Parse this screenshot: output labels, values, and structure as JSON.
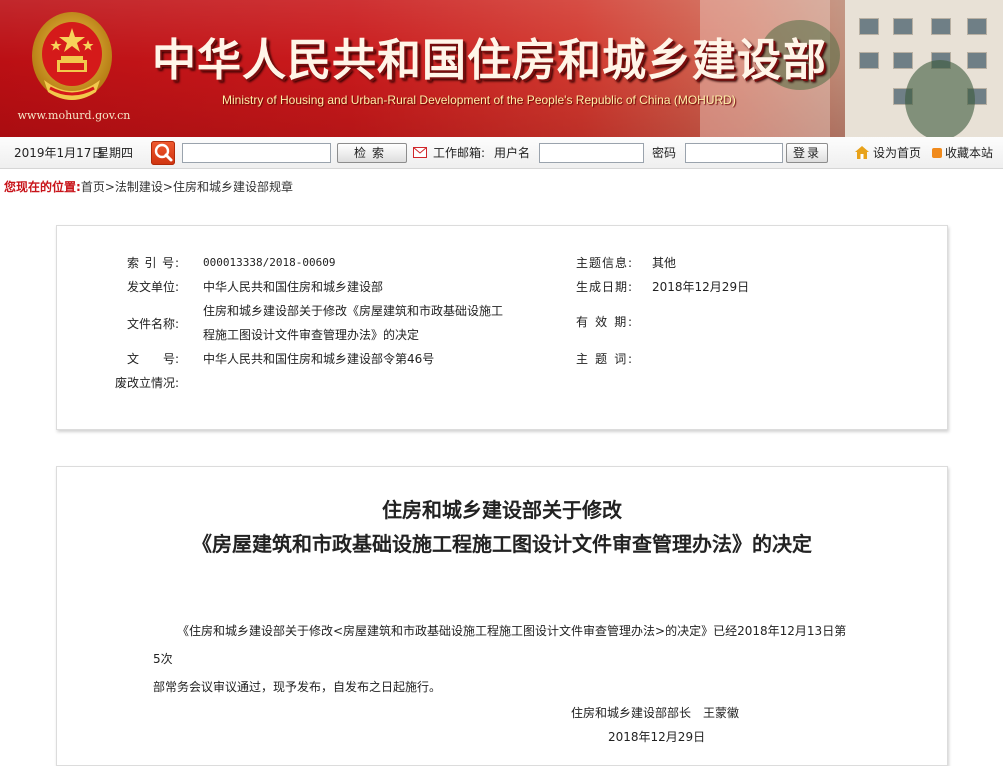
{
  "header": {
    "site_url": "www.mohurd.gov.cn",
    "title_cn": "中华人民共和国住房和城乡建设部",
    "title_en": "Ministry of Housing and Urban-Rural Development of the People's Republic of China (MOHURD)",
    "colors": {
      "banner_red": "#c91a1c",
      "title_gold": "#ffefa8"
    }
  },
  "toolbar": {
    "date": "2019年1月17日",
    "weekday": "星期四",
    "search_value": "",
    "search_button": "检索",
    "mail_label": "工作邮箱:",
    "username_label": "用户名",
    "username_value": "",
    "password_label": "密码",
    "password_value": "",
    "login_button": "登录",
    "set_home": "设为首页",
    "bookmark": "收藏本站"
  },
  "breadcrumb": {
    "label": "您现在的位置:",
    "items": [
      "首页",
      ">",
      "法制建设",
      ">",
      "住房和城乡建设部规章"
    ]
  },
  "info": {
    "index_label": "索 引 号:",
    "index_value": "000013338/2018-00609",
    "issuer_label": "发文单位:",
    "issuer_value": "中华人民共和国住房和城乡建设部",
    "name_label": "文件名称:",
    "name_value_line1": "住房和城乡建设部关于修改《房屋建筑和市政基础设施工",
    "name_value_line2": "程施工图设计文件审查管理办法》的决定",
    "docno_label": "文　　号:",
    "docno_value": "中华人民共和国住房和城乡建设部令第46号",
    "status_label": "废改立情况:",
    "status_value": "",
    "topic_label": "主题信息:",
    "topic_value": "其他",
    "date_label": "生成日期:",
    "date_value": "2018年12月29日",
    "validity_label": "有 效 期:",
    "validity_value": "",
    "keyword_label": "主 题 词:",
    "keyword_value": ""
  },
  "article": {
    "title_line1": "住房和城乡建设部关于修改",
    "title_line2": "《房屋建筑和市政基础设施工程施工图设计文件审查管理办法》的决定",
    "body_line1": "《住房和城乡建设部关于修改<房屋建筑和市政基础设施工程施工图设计文件审查管理办法>的决定》已经2018年12月13日第5次",
    "body_line2": "部常务会议审议通过，现予发布，自发布之日起施行。",
    "signer": "住房和城乡建设部部长　王蒙徽",
    "sign_date": "2018年12月29日"
  }
}
